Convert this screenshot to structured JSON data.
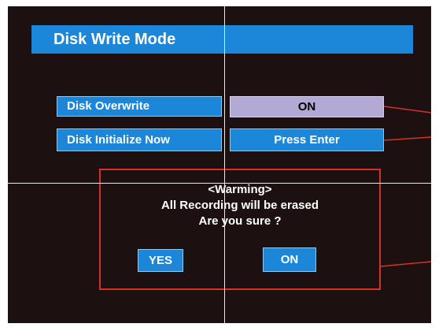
{
  "title": "Disk Write Mode",
  "settings": [
    {
      "label": "Disk Overwrite",
      "value": "ON"
    },
    {
      "label": "Disk Initialize Now",
      "value": "Press Enter"
    }
  ],
  "dialog": {
    "heading": "<Warming>",
    "message": "All Recording will be erased",
    "question": "Are you sure ?",
    "yes_label": "YES",
    "no_label": "ON"
  },
  "colors": {
    "background": "#1d1011",
    "panel_blue": "#1c86d8",
    "selected_value": "#b3a9d5",
    "callout_red": "#d93028"
  }
}
